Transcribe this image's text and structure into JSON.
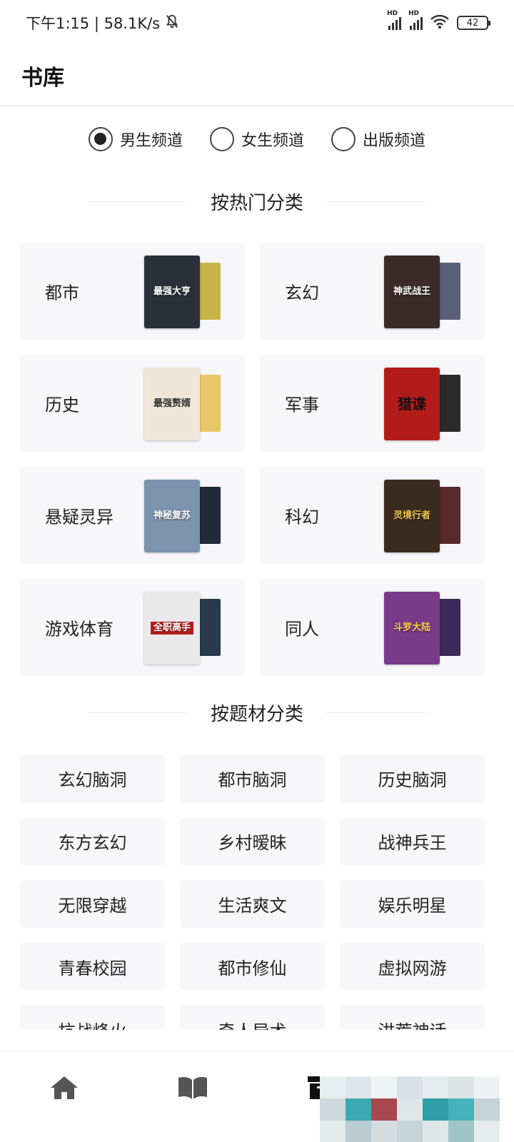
{
  "status_bar": {
    "time_speed": "下午1:15 | 58.1K/s",
    "signal1_label": "HD",
    "signal2_label": "HD",
    "battery": "42"
  },
  "header": {
    "title": "书库"
  },
  "channels": [
    {
      "label": "男生频道",
      "selected": true
    },
    {
      "label": "女生频道",
      "selected": false
    },
    {
      "label": "出版频道",
      "selected": false
    }
  ],
  "hot_section": {
    "title": "按热门分类",
    "categories": [
      {
        "label": "都市",
        "cover_text": "最强大亨",
        "cover_color": "#2b2f3a",
        "back_color": "#c9b44a"
      },
      {
        "label": "玄幻",
        "cover_text": "神武战王",
        "cover_color": "#3a2a2a",
        "back_color": "#5a5f7a"
      },
      {
        "label": "历史",
        "cover_text": "最强赘婿",
        "cover_color": "#efe6d8",
        "back_color": "#e8c76a"
      },
      {
        "label": "军事",
        "cover_text": "猎谍",
        "cover_color": "#b31b1b",
        "back_color": "#2a2a2a"
      },
      {
        "label": "悬疑灵异",
        "cover_text": "神秘复苏",
        "cover_color": "#7b93ad",
        "back_color": "#1f2a3a"
      },
      {
        "label": "科幻",
        "cover_text": "灵境行者",
        "cover_color": "#3b2a1e",
        "back_color": "#5a2a2a"
      },
      {
        "label": "游戏体育",
        "cover_text": "全职高手",
        "cover_color": "#e9e9e9",
        "back_color": "#2a3a4a"
      },
      {
        "label": "同人",
        "cover_text": "斗罗大陆",
        "cover_color": "#7a3a8a",
        "back_color": "#3a2a5a"
      }
    ]
  },
  "topic_section": {
    "title": "按题材分类",
    "topics": [
      "玄幻脑洞",
      "都市脑洞",
      "历史脑洞",
      "东方玄幻",
      "乡村暧昧",
      "战神兵王",
      "无限穿越",
      "生活爽文",
      "娱乐明星",
      "青春校园",
      "都市修仙",
      "虚拟网游",
      "抗战烽火",
      "奇人异术",
      "洪荒神话"
    ]
  },
  "bottom_nav": {
    "items": [
      "home-icon",
      "book-icon",
      "archive-icon",
      "menu-icon"
    ],
    "icon_color": "#555555"
  },
  "colors": {
    "card_bg": "#f7f7f9",
    "text": "#222222"
  }
}
